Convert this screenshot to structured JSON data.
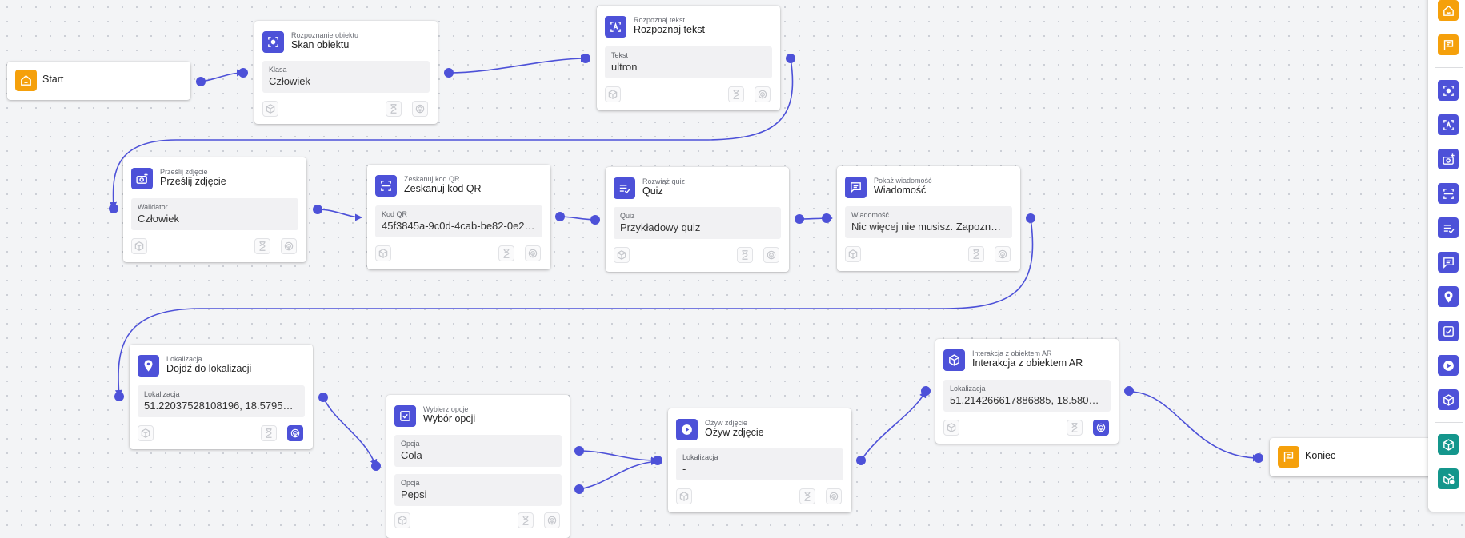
{
  "nodes": {
    "start": {
      "label": "Start"
    },
    "scan_object": {
      "subtitle": "Rozpoznanie obiektu",
      "title": "Skan obiektu",
      "field_label": "Klasa",
      "field_value": "Człowiek"
    },
    "recognize_text": {
      "subtitle": "Rozpoznaj tekst",
      "title": "Rozpoznaj tekst",
      "field_label": "Tekst",
      "field_value": "ultron"
    },
    "send_photo": {
      "subtitle": "Prześlij zdjęcie",
      "title": "Prześlij zdjęcie",
      "field_label": "Walidator",
      "field_value": "Człowiek"
    },
    "scan_qr": {
      "subtitle": "Zeskanuj kod QR",
      "title": "Zeskanuj kod QR",
      "field_label": "Kod QR",
      "field_value": "45f3845a-9c0d-4cab-be82-0e2b6..."
    },
    "quiz": {
      "subtitle": "Rozwiąż quiz",
      "title": "Quiz",
      "field_label": "Quiz",
      "field_value": "Przykładowy quiz"
    },
    "message": {
      "subtitle": "Pokaż wiadomość",
      "title": "Wiadomość",
      "field_label": "Wiadomość",
      "field_value": "Nic więcej nie musisz. Zapoznaj s..."
    },
    "location": {
      "subtitle": "Lokalizacja",
      "title": "Dojdź do lokalizacji",
      "field_label": "Lokalizacja",
      "field_value": "51.22037528108196, 18.579576..."
    },
    "choice": {
      "subtitle": "Wybierz opcje",
      "title": "Wybór opcji",
      "options": [
        {
          "label": "Opcja",
          "value": "Cola"
        },
        {
          "label": "Opcja",
          "value": "Pepsi"
        }
      ]
    },
    "animate_photo": {
      "subtitle": "Ożyw zdjęcie",
      "title": "Ożyw zdjęcie",
      "field_label": "Lokalizacja",
      "field_value": "-"
    },
    "ar_interaction": {
      "subtitle": "Interakcja z obiektem AR",
      "title": "Interakcja z obiektem AR",
      "field_label": "Lokalizacja",
      "field_value": "51.214266617886885, 18.58000..."
    },
    "end": {
      "label": "Koniec"
    }
  },
  "palette": [
    "home-icon",
    "flag-icon",
    "scan-object-icon",
    "text-recognition-icon",
    "add-photo-icon",
    "qr-scan-icon",
    "quiz-icon",
    "message-icon",
    "location-icon",
    "checkbox-icon",
    "play-icon",
    "ar-cube-icon",
    "ar-cube-teal-icon",
    "ar-cube-settings-icon"
  ],
  "colors": {
    "accent": "#4d51d8",
    "start_end": "#f5a00b",
    "ar_palette": "#14968c",
    "edge": "#4d51d8",
    "canvas": "#f3f4f6"
  }
}
